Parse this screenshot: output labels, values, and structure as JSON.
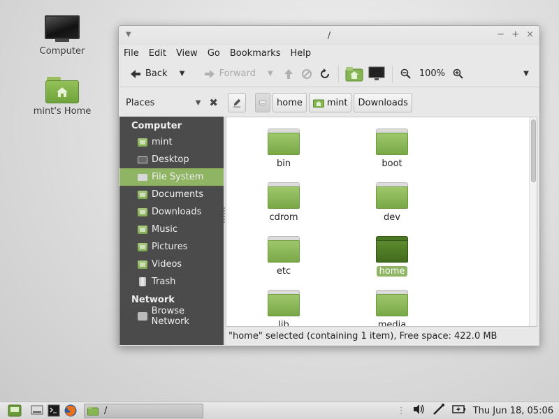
{
  "desktop": {
    "icons": [
      {
        "label": "Computer",
        "icon": "computer-icon"
      },
      {
        "label": "mint's Home",
        "icon": "home-folder-icon"
      }
    ]
  },
  "window": {
    "title": "/",
    "controls": {
      "minimize": "−",
      "maximize": "+",
      "close": "×"
    },
    "menu": [
      "File",
      "Edit",
      "View",
      "Go",
      "Bookmarks",
      "Help"
    ],
    "toolbar": {
      "back": "Back",
      "forward": "Forward",
      "zoom": "100%"
    },
    "places_label": "Places",
    "breadcrumbs": [
      "home",
      "mint",
      "Downloads"
    ],
    "sidebar": {
      "sections": [
        {
          "heading": "Computer",
          "items": [
            {
              "label": "mint",
              "icon": "home-folder-icon"
            },
            {
              "label": "Desktop",
              "icon": "desktop-icon"
            },
            {
              "label": "File System",
              "icon": "drive-icon",
              "selected": true
            },
            {
              "label": "Documents",
              "icon": "documents-folder-icon"
            },
            {
              "label": "Downloads",
              "icon": "downloads-folder-icon"
            },
            {
              "label": "Music",
              "icon": "music-folder-icon"
            },
            {
              "label": "Pictures",
              "icon": "pictures-folder-icon"
            },
            {
              "label": "Videos",
              "icon": "videos-folder-icon"
            },
            {
              "label": "Trash",
              "icon": "trash-icon"
            }
          ]
        },
        {
          "heading": "Network",
          "items": [
            {
              "label": "Browse Network",
              "icon": "network-icon"
            }
          ]
        }
      ]
    },
    "folders": [
      {
        "name": "bin",
        "selected": false
      },
      {
        "name": "boot",
        "selected": false
      },
      {
        "name": "cdrom",
        "selected": false
      },
      {
        "name": "dev",
        "selected": false
      },
      {
        "name": "etc",
        "selected": false
      },
      {
        "name": "home",
        "selected": true
      },
      {
        "name": "lib",
        "selected": false
      },
      {
        "name": "media",
        "selected": false
      }
    ],
    "status": "\"home\" selected (containing 1 item), Free space: 422.0 MB"
  },
  "panel": {
    "task_title": "/",
    "clock": "Thu Jun 18, 05:06"
  },
  "colors": {
    "accent": "#8eb464",
    "sidebar_bg": "#4b4b4b",
    "folder_green": "#79a847"
  }
}
